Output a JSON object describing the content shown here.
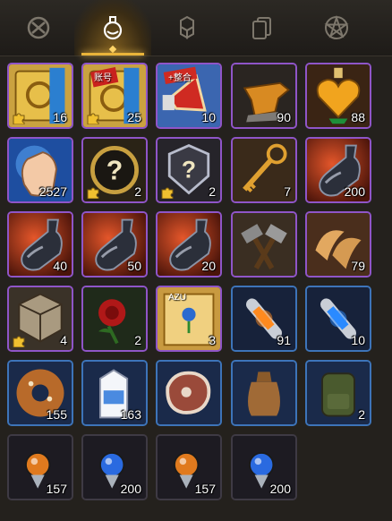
{
  "tabs": [
    {
      "icon": "shield-tab-icon",
      "active": false
    },
    {
      "icon": "potion-flask-icon",
      "active": true
    },
    {
      "icon": "cubes-icon",
      "active": false
    },
    {
      "icon": "cards-icon",
      "active": false
    },
    {
      "icon": "pentagram-icon",
      "active": false
    }
  ],
  "inventory": {
    "rows": [
      [
        {
          "name": "golden-scroll",
          "qty": "16",
          "fragment": true,
          "rarity": "purple"
        },
        {
          "name": "golden-scroll-stamped",
          "qty": "25",
          "fragment": true,
          "rarity": "purple",
          "stamp": "账号"
        },
        {
          "name": "megaphone",
          "qty": "10",
          "fragment": false,
          "rarity": "purple",
          "stamp": "+整合"
        },
        {
          "name": "anvil",
          "qty": "90",
          "fragment": false,
          "rarity": "purple"
        },
        {
          "name": "golden-heart-flask",
          "qty": "88",
          "fragment": false,
          "rarity": "purple"
        }
      ],
      [
        {
          "name": "glowing-hand",
          "qty": "2527",
          "fragment": false,
          "rarity": "purple"
        },
        {
          "name": "mystery-medal-gold",
          "qty": "2",
          "fragment": true,
          "rarity": "purple"
        },
        {
          "name": "mystery-medal-silver",
          "qty": "2",
          "fragment": true,
          "rarity": "purple"
        },
        {
          "name": "ornate-key",
          "qty": "7",
          "fragment": false,
          "rarity": "purple"
        },
        {
          "name": "fire-bottle",
          "qty": "200",
          "fragment": false,
          "rarity": "purple"
        }
      ],
      [
        {
          "name": "blue-bottle",
          "qty": "40",
          "fragment": false,
          "rarity": "purple"
        },
        {
          "name": "white-bottle",
          "qty": "50",
          "fragment": false,
          "rarity": "purple"
        },
        {
          "name": "purple-bottle",
          "qty": "20",
          "fragment": false,
          "rarity": "purple"
        },
        {
          "name": "hammers",
          "qty": "",
          "fragment": false,
          "rarity": "purple"
        },
        {
          "name": "fortune-cookies",
          "qty": "79",
          "fragment": false,
          "rarity": "purple"
        }
      ],
      [
        {
          "name": "ornate-cube",
          "qty": "4",
          "fragment": true,
          "rarity": "purple"
        },
        {
          "name": "red-rose",
          "qty": "2",
          "fragment": false,
          "rarity": "purple"
        },
        {
          "name": "flower-scroll",
          "qty": "3",
          "fragment": false,
          "rarity": "purple",
          "stamp": "AZU"
        },
        {
          "name": "orange-crystal",
          "qty": "91",
          "fragment": false,
          "rarity": "blue"
        },
        {
          "name": "blue-crystal",
          "qty": "10",
          "fragment": false,
          "rarity": "blue"
        }
      ],
      [
        {
          "name": "donut",
          "qty": "155",
          "fragment": false,
          "rarity": "blue"
        },
        {
          "name": "milk-carton",
          "qty": "163",
          "fragment": false,
          "rarity": "blue"
        },
        {
          "name": "steak",
          "qty": "",
          "fragment": false,
          "rarity": "blue"
        },
        {
          "name": "sack",
          "qty": "",
          "fragment": false,
          "rarity": "blue"
        },
        {
          "name": "backpack",
          "qty": "2",
          "fragment": false,
          "rarity": "blue"
        }
      ],
      [
        {
          "name": "orange-orb",
          "qty": "157",
          "fragment": false,
          "rarity": "dark"
        },
        {
          "name": "blue-orb",
          "qty": "200",
          "fragment": false,
          "rarity": "dark"
        },
        {
          "name": "orange-orb",
          "qty": "157",
          "fragment": false,
          "rarity": "dark"
        },
        {
          "name": "blue-orb",
          "qty": "200",
          "fragment": false,
          "rarity": "dark"
        }
      ]
    ]
  },
  "colors": {
    "accent": "#e9b43a",
    "purple_frame": "#8f55c8",
    "blue_frame": "#3d74b9",
    "dark_frame": "#3e3a44",
    "background": "#24211d"
  }
}
